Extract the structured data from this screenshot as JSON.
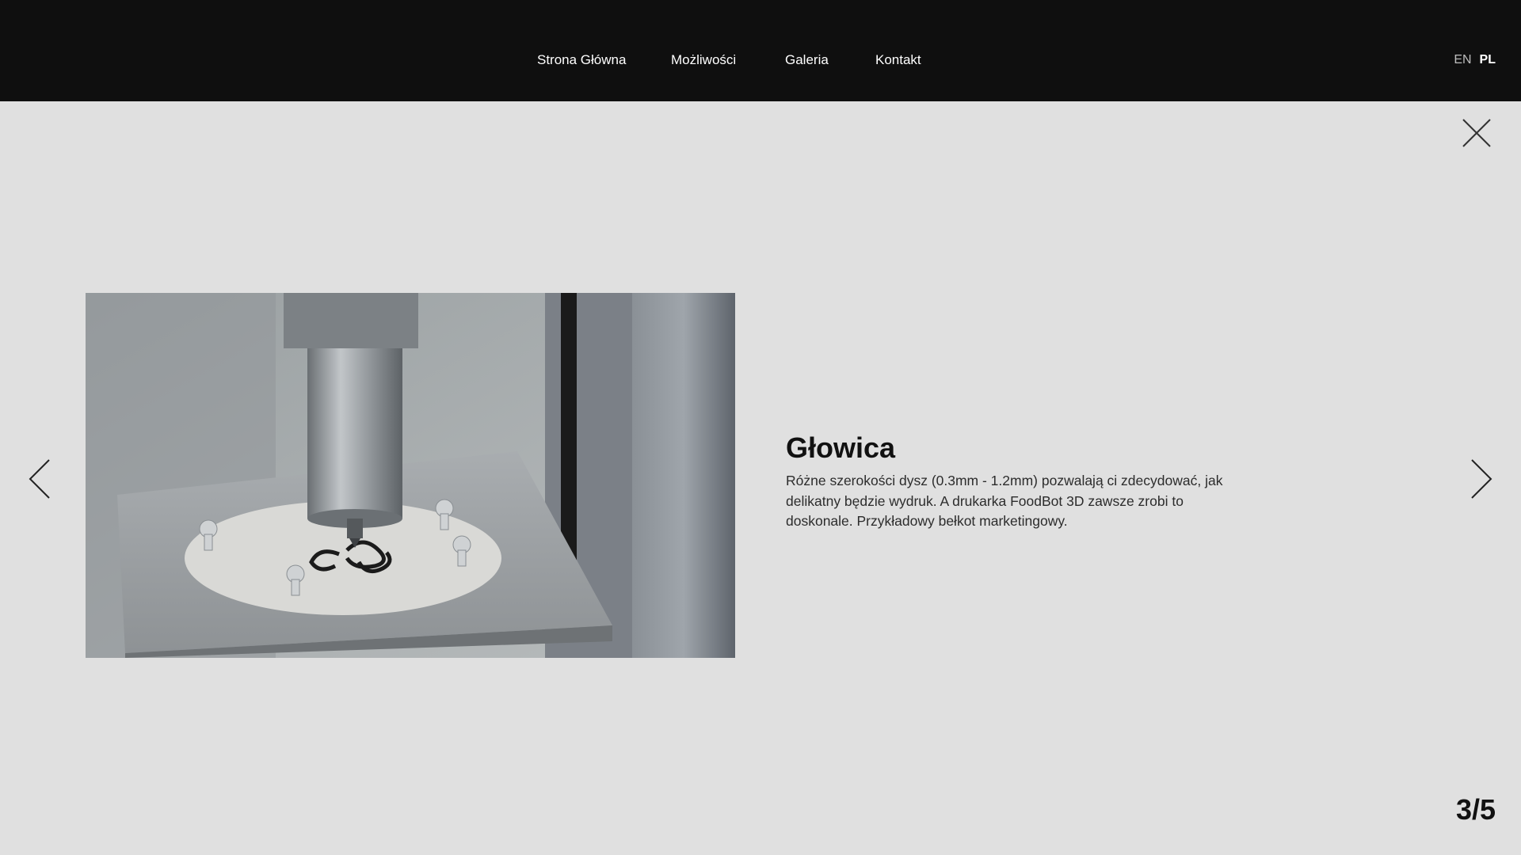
{
  "nav": {
    "items": [
      {
        "label": "Strona Główna"
      },
      {
        "label": "Możliwości"
      },
      {
        "label": "Galeria"
      },
      {
        "label": "Kontakt"
      }
    ]
  },
  "language": {
    "options": [
      "EN",
      "PL"
    ],
    "selected": "PL"
  },
  "icons": {
    "close": "close-icon",
    "previous": "chevron-left-icon",
    "next": "chevron-right-icon"
  },
  "slide": {
    "title": "Głowica",
    "description": "Różne szerokości dysz (0.3mm - 1.2mm) pozwalają ci zdecydować, jak delikatny będzie wydruk. A drukarka FoodBot 3D zawsze zrobi to doskonale. Przykładowy bełkot marketingowy."
  },
  "counter": "3/5",
  "colors": {
    "header_bg": "#0f0f0f",
    "page_bg": "#e0e0e0",
    "text": "#111111"
  }
}
